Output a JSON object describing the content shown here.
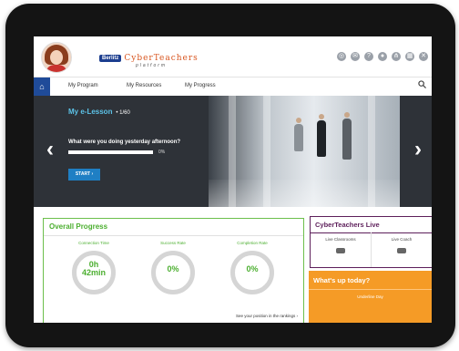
{
  "brand": {
    "logo": "Berlitz",
    "name": "CyberTeachers",
    "sub": "platform"
  },
  "header_icons": [
    "help-icon",
    "mail-icon",
    "question-icon",
    "user-icon",
    "share-icon",
    "calendar-icon",
    "close-icon"
  ],
  "nav": {
    "items": [
      "My Program",
      "My Resources",
      "My Progress"
    ]
  },
  "hero": {
    "lesson_label": "My e-Lesson",
    "lesson_count": "1/60",
    "question": "What were you doing yesterday afternoon?",
    "progress_text": "0%",
    "progress": 0,
    "start": "START"
  },
  "overall": {
    "title": "Overall Progress",
    "stats": [
      {
        "label": "Connection Time",
        "value_line1": "0h",
        "value_line2": "42min"
      },
      {
        "label": "Success Rate",
        "value": "0%"
      },
      {
        "label": "Completion Rate",
        "value": "0%"
      }
    ],
    "ranking_link": "See your position in the rankings"
  },
  "live": {
    "title": "CyberTeachers Live",
    "items": [
      "Live Classrooms",
      "Live Coach"
    ]
  },
  "today": {
    "title": "What's up today?",
    "sub": "Underline Day"
  }
}
